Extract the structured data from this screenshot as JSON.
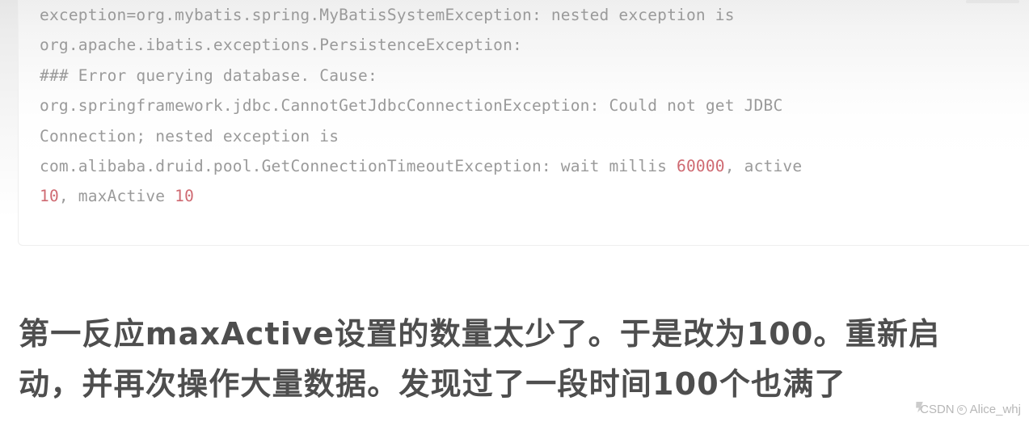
{
  "page": {
    "background_top": "#e6e6e6",
    "background_bottom": "#ffffff"
  },
  "code_block": {
    "text_color": "#9a9a9a",
    "highlight_color": "#cf6a72",
    "border_color": "#eeeeee",
    "lines": [
      {
        "id": "line-1",
        "segments": [
          {
            "text": "exception=org.mybatis.spring.MyBatisSystemException: nested exception is",
            "highlight": false
          }
        ],
        "plain": "exception=org.mybatis.spring.MyBatisSystemException: nested exception is"
      },
      {
        "id": "line-2",
        "segments": [
          {
            "text": "org.apache.ibatis.exceptions.PersistenceException:",
            "highlight": false
          }
        ],
        "plain": "org.apache.ibatis.exceptions.PersistenceException:"
      },
      {
        "id": "line-3",
        "segments": [
          {
            "text": "### Error querying database. Cause:",
            "highlight": false
          }
        ],
        "plain": "### Error querying database. Cause:"
      },
      {
        "id": "line-4",
        "segments": [
          {
            "text": "org.springframework.jdbc.CannotGetJdbcConnectionException: Could not get JDBC",
            "highlight": false
          }
        ],
        "plain": "org.springframework.jdbc.CannotGetJdbcConnectionException: Could not get JDBC"
      },
      {
        "id": "line-5",
        "segments": [
          {
            "text": "Connection; nested exception is",
            "highlight": false
          }
        ],
        "plain": "Connection; nested exception is"
      },
      {
        "id": "line-6",
        "segments": [
          {
            "text": "com.alibaba.druid.pool.GetConnectionTimeoutException: wait millis ",
            "highlight": false
          },
          {
            "text": "60000",
            "highlight": true
          },
          {
            "text": ", active",
            "highlight": false
          }
        ],
        "plain": "com.alibaba.druid.pool.GetConnectionTimeoutException: wait millis 60000, active"
      },
      {
        "id": "line-7",
        "segments": [
          {
            "text": "10",
            "highlight": true
          },
          {
            "text": ", maxActive ",
            "highlight": false
          },
          {
            "text": "10",
            "highlight": true
          }
        ],
        "plain": "10, maxActive 10"
      }
    ]
  },
  "prose": {
    "text_color": "#4e4e4e",
    "lines": [
      "第一反应maxActive设置的数量太少了。于是改为100。重新启",
      "动，并再次操作大量数据。发现过了一段时间100个也满了"
    ],
    "full_text": "第一反应maxActive设置的数量太少了。于是改为100。重新启动，并再次操作大量数据。发现过了一段时间100个也满了"
  },
  "watermark": {
    "brand": "CSDN",
    "handle": "Alice_whj",
    "text": "CSDN @Alice_whj",
    "color": "#b4b4b4"
  }
}
